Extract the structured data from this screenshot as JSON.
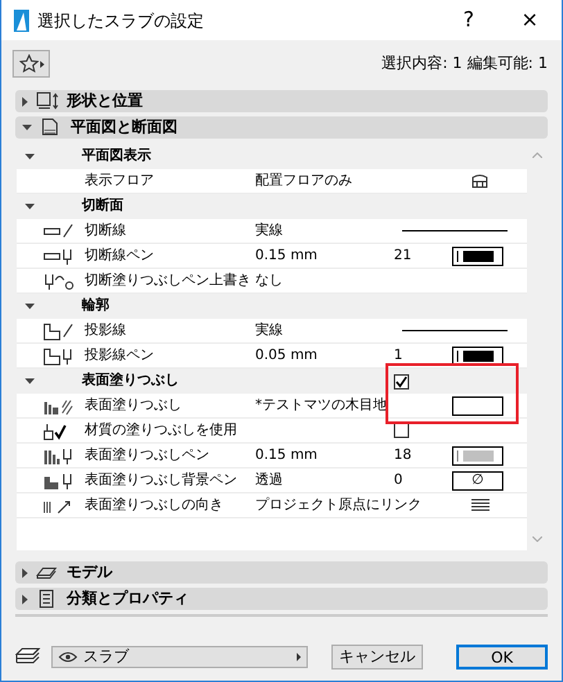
{
  "window": {
    "title": "選択したスラブの設定",
    "help": "?",
    "close": "×"
  },
  "toolbar": {
    "summary": "選択内容: 1 編集可能: 1"
  },
  "sections": [
    {
      "title": "形状と位置",
      "expanded": false
    },
    {
      "title": "平面図と断面図",
      "expanded": true,
      "groups": [
        {
          "title": "平面図表示",
          "expanded": true,
          "rows": [
            {
              "label": "表示フロア",
              "value": "配置フロアのみ",
              "kind": "floor"
            }
          ]
        },
        {
          "title": "切断面",
          "expanded": true,
          "rows": [
            {
              "label": "切断線",
              "value": "実線",
              "kind": "line"
            },
            {
              "label": "切断線ペン",
              "value": "0.15 mm",
              "number": "21",
              "kind": "pen",
              "color": "#000000"
            },
            {
              "label": "切断塗りつぶしペン上書き",
              "value": "なし",
              "kind": "none"
            }
          ]
        },
        {
          "title": "輪郭",
          "expanded": true,
          "rows": [
            {
              "label": "投影線",
              "value": "実線",
              "kind": "line"
            },
            {
              "label": "投影線ペン",
              "value": "0.05 mm",
              "number": "1",
              "kind": "pen",
              "color": "#000000"
            }
          ]
        },
        {
          "title": "表面塗りつぶし",
          "expanded": true,
          "checked": true,
          "highlighted": true,
          "rows": [
            {
              "label": "表面塗りつぶし",
              "value": "*テストマツの木目地",
              "kind": "fill",
              "highlighted": true
            },
            {
              "label": "材質の塗りつぶしを使用",
              "kind": "checkbox",
              "checked": false
            },
            {
              "label": "表面塗りつぶしペン",
              "value": "0.15 mm",
              "number": "18",
              "kind": "pen",
              "color": "#c0c0c0"
            },
            {
              "label": "表面塗りつぶし背景ペン",
              "value": "透過",
              "number": "0",
              "kind": "transparent",
              "symbol": "∅"
            },
            {
              "label": "表面塗りつぶしの向き",
              "value": "プロジェクト原点にリンク",
              "kind": "hatch"
            }
          ]
        }
      ]
    },
    {
      "title": "モデル",
      "expanded": false
    },
    {
      "title": "分類とプロパティ",
      "expanded": false
    }
  ],
  "footer": {
    "layer": "スラブ",
    "cancel": "キャンセル",
    "ok": "OK"
  }
}
